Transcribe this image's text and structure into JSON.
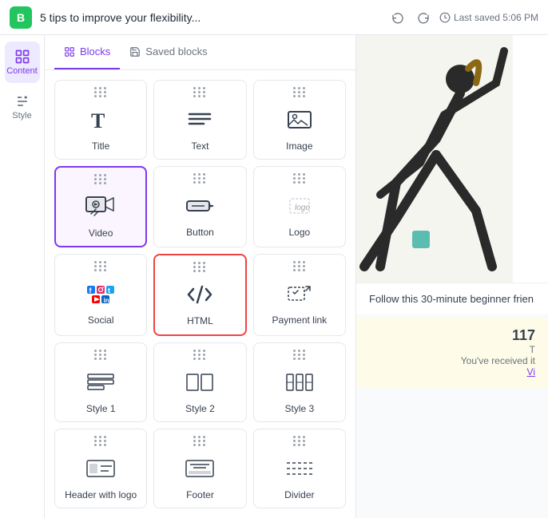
{
  "topbar": {
    "logo": "B",
    "title": "5 tips to improve your flexibility...",
    "last_saved": "Last saved 5:06 PM"
  },
  "nav": {
    "items": [
      {
        "id": "content",
        "label": "Content",
        "active": true
      },
      {
        "id": "style",
        "label": "Style",
        "active": false
      }
    ]
  },
  "tabs": [
    {
      "id": "blocks",
      "label": "Blocks",
      "active": true
    },
    {
      "id": "saved",
      "label": "Saved blocks",
      "active": false
    }
  ],
  "blocks": [
    {
      "id": "title",
      "label": "Title",
      "icon": "title"
    },
    {
      "id": "text",
      "label": "Text",
      "icon": "text"
    },
    {
      "id": "image",
      "label": "Image",
      "icon": "image"
    },
    {
      "id": "video",
      "label": "Video",
      "icon": "video",
      "highlighted": true
    },
    {
      "id": "button",
      "label": "Button",
      "icon": "button"
    },
    {
      "id": "logo",
      "label": "Logo",
      "icon": "logo"
    },
    {
      "id": "social",
      "label": "Social",
      "icon": "social"
    },
    {
      "id": "html",
      "label": "HTML",
      "icon": "html",
      "selected": true
    },
    {
      "id": "payment",
      "label": "Payment link",
      "icon": "payment"
    },
    {
      "id": "style1",
      "label": "Style 1",
      "icon": "style1"
    },
    {
      "id": "style2",
      "label": "Style 2",
      "icon": "style2"
    },
    {
      "id": "style3",
      "label": "Style 3",
      "icon": "style3"
    },
    {
      "id": "header-logo",
      "label": "Header with logo",
      "icon": "header-logo"
    },
    {
      "id": "footer",
      "label": "Footer",
      "icon": "footer"
    },
    {
      "id": "divider",
      "label": "Divider",
      "icon": "divider"
    }
  ],
  "preview": {
    "follow_text": "Follow this 30-minute beginner frien",
    "number": "117",
    "sub_text": "T",
    "received_text": "You've received it",
    "link_text": "Vi"
  }
}
